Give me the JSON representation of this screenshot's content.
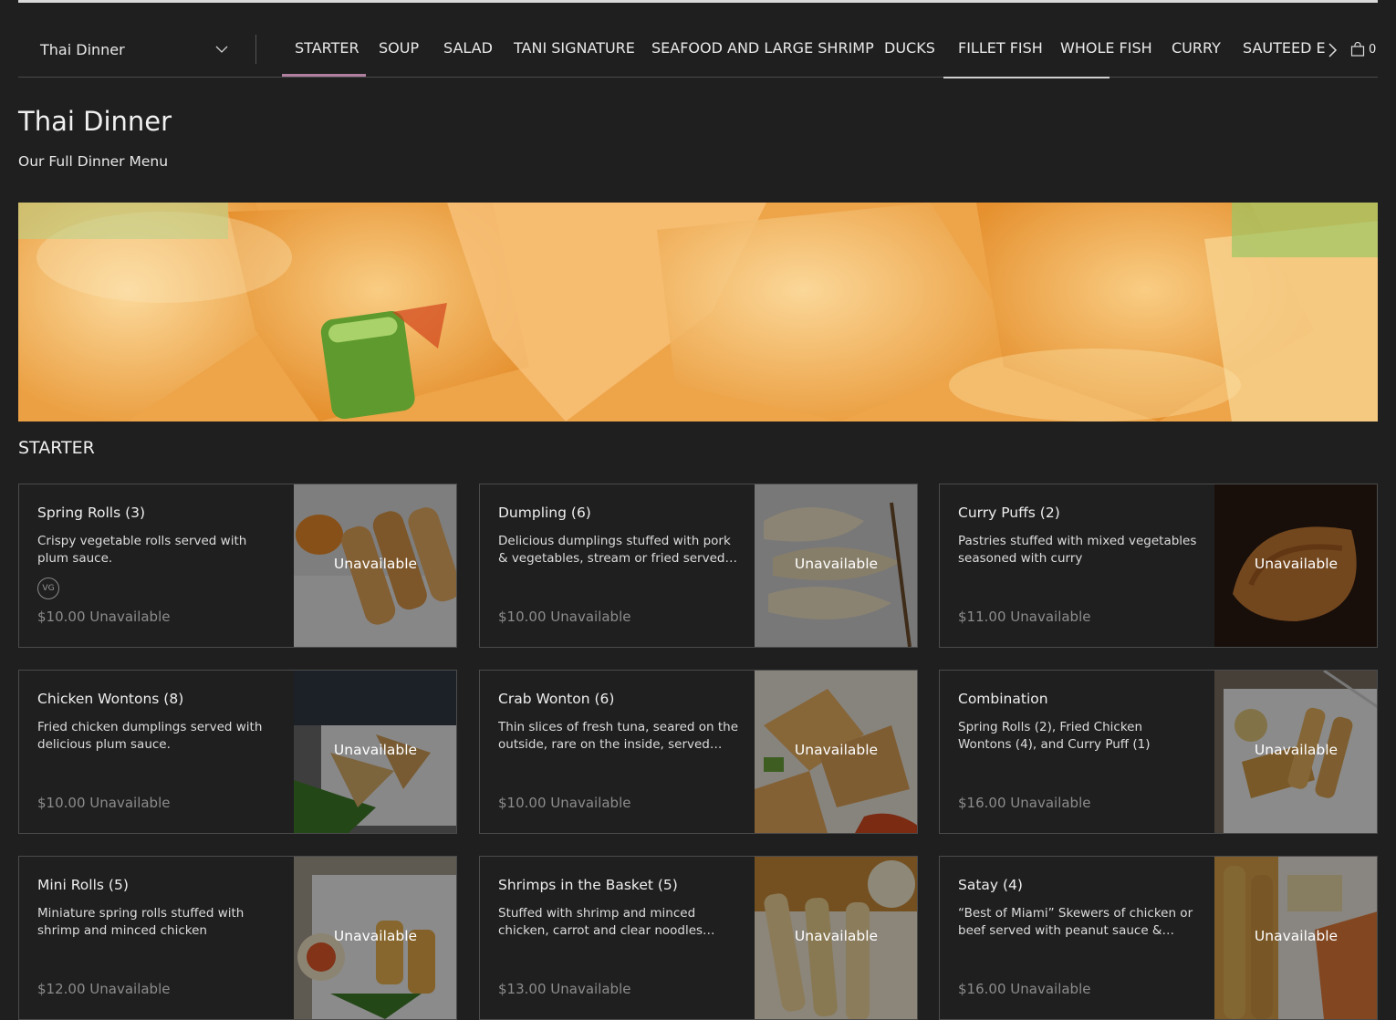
{
  "menu_selector": {
    "label": "Thai Dinner"
  },
  "tabs": [
    {
      "label": "STARTER"
    },
    {
      "label": "SOUP"
    },
    {
      "label": "SALAD"
    },
    {
      "label": "TANI SIGNATURE"
    },
    {
      "label": "SEAFOOD AND LARGE SHRIMP"
    },
    {
      "label": "DUCKS"
    },
    {
      "label": "FILLET FISH"
    },
    {
      "label": "WHOLE FISH"
    },
    {
      "label": "CURRY"
    },
    {
      "label": "SAUTEED E"
    }
  ],
  "active_tab": "STARTER",
  "cart": {
    "count": "0"
  },
  "page": {
    "title": "Thai Dinner",
    "subtitle": "Our Full Dinner Menu"
  },
  "section": {
    "title": "STARTER"
  },
  "items": [
    {
      "name": "Spring Rolls (3)",
      "desc": "Crispy vegetable rolls served with plum sauce.",
      "tag": "VG",
      "price": "$10.00",
      "status": "Unavailable",
      "overlay": "Unavailable"
    },
    {
      "name": "Dumpling (6)",
      "desc": "Delicious dumplings stuffed with pork & vegetables, stream or fried served with…",
      "tag": "",
      "price": "$10.00",
      "status": "Unavailable",
      "overlay": "Unavailable"
    },
    {
      "name": "Curry Puffs (2)",
      "desc": "Pastries stuffed with mixed vegetables seasoned with curry",
      "tag": "",
      "price": "$11.00",
      "status": "Unavailable",
      "overlay": "Unavailable"
    },
    {
      "name": "Chicken Wontons (8)",
      "desc": "Fried chicken dumplings served with delicious plum sauce.",
      "tag": "",
      "price": "$10.00",
      "status": "Unavailable",
      "overlay": "Unavailable"
    },
    {
      "name": "Crab Wonton (6)",
      "desc": "Thin slices of fresh tuna, seared on the outside, rare on the inside, served with…",
      "tag": "",
      "price": "$10.00",
      "status": "Unavailable",
      "overlay": "Unavailable"
    },
    {
      "name": "Combination",
      "desc": "Spring Rolls (2), Fried Chicken Wontons (4), and Curry Puff (1)",
      "tag": "",
      "price": "$16.00",
      "status": "Unavailable",
      "overlay": "Unavailable"
    },
    {
      "name": "Mini Rolls (5)",
      "desc": "Miniature spring rolls stuffed with shrimp and minced chicken",
      "tag": "",
      "price": "$12.00",
      "status": "Unavailable",
      "overlay": "Unavailable"
    },
    {
      "name": "Shrimps in the Basket (5)",
      "desc": "Stuffed with shrimp and minced chicken, carrot and clear noodles…",
      "tag": "",
      "price": "$13.00",
      "status": "Unavailable",
      "overlay": "Unavailable"
    },
    {
      "name": "Satay (4)",
      "desc": "“Best of Miami” Skewers of chicken or beef served with peanut sauce &…",
      "tag": "",
      "price": "$16.00",
      "status": "Unavailable",
      "overlay": "Unavailable"
    }
  ]
}
